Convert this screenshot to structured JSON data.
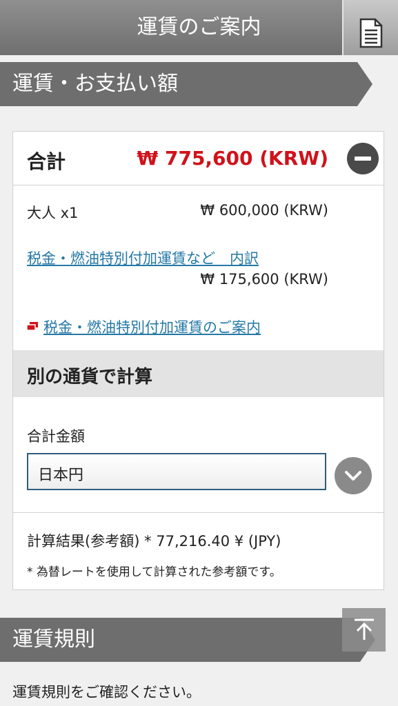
{
  "header": {
    "title": "運賃のご案内",
    "doc_icon": "document-icon"
  },
  "fare_section": {
    "title": "運賃・お支払い額"
  },
  "total": {
    "label": "合計",
    "amount": "₩ 775,600 (KRW)"
  },
  "breakdown": {
    "adult_label": "大人 x1",
    "adult_amount": "₩ 600,000 (KRW)",
    "tax_link": "税金・燃油特別付加運賃など　内訳",
    "tax_amount": "₩ 175,600 (KRW)",
    "info_link": "税金・燃油特別付加運賃のご案内"
  },
  "converter": {
    "title": "別の通貨で計算",
    "field_label": "合計金額",
    "selected_currency": "日本円",
    "result": "計算結果(参考額) *  77,216.40 ¥ (JPY)",
    "note": "* 為替レートを使用して計算された参考額です。"
  },
  "rules_section": {
    "title": "運賃規則",
    "text": "運賃規則をご確認ください。"
  },
  "colors": {
    "total_red": "#d0121b",
    "link_blue": "#2478a6",
    "section_gray": "#6e6e6e"
  }
}
